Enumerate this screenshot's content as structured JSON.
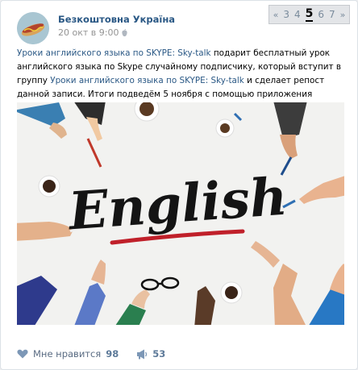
{
  "post": {
    "author": "Безкоштовна Україна",
    "date": "20 окт в 9:00",
    "text": {
      "link1": "Уроки английского языка по SKYPE: Sky-talk",
      "part1": " подарит бесплатный урок английского языка по Skype случайному подписчику, который вступит в группу ",
      "link2": "Уроки английского языка по SKYPE: Sky-talk",
      "part2": " и сделает репост данной записи. Итоги подведём 5 ноября с помощью приложения \"Выбиратель\""
    },
    "image_word": "English"
  },
  "pager": {
    "prev_icon": "double-left-arrow",
    "next_icon": "double-right-arrow",
    "pages": [
      "3",
      "4",
      "5",
      "6",
      "7"
    ],
    "current": "5"
  },
  "footer": {
    "like_label": "Мне нравится",
    "like_count": "98",
    "share_count": "53"
  },
  "colors": {
    "link": "#2a5885",
    "muted": "#939393",
    "background": "#edeef0"
  }
}
